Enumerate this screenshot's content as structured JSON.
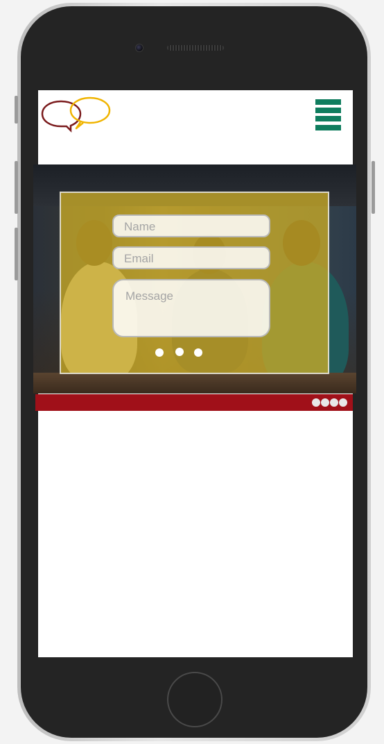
{
  "form": {
    "name_placeholder": "Name",
    "email_placeholder": "Email",
    "message_placeholder": "Message"
  },
  "carousel": {
    "dots": 3
  },
  "pagination": {
    "dots": 4
  },
  "colors": {
    "menu": "#0f7d5e",
    "overlay": "#c9aa26",
    "bar": "#a01019",
    "logo_left": "#7a1a1c",
    "logo_right": "#f0b400"
  },
  "icons": {
    "menu": "hamburger-menu-icon",
    "logo": "speech-bubbles-logo"
  }
}
